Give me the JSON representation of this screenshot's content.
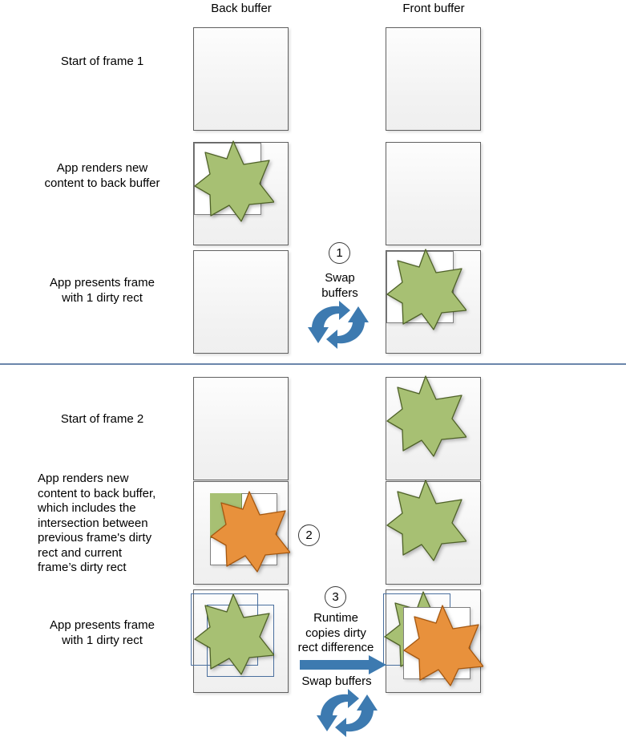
{
  "diagram": {
    "title": "Back buffer / front buffer dirty rect flip-model diagram",
    "colors": {
      "green_star": "#a7c073",
      "green_star_outline": "#4f6228",
      "orange_star": "#e8913c",
      "orange_star_outline": "#a5570f",
      "buffer_fill": "#f3f3f3",
      "buffer_border": "#616161",
      "dirty_rect_border": "#7f7f7f",
      "dirty_rect_blue_border": "#4a6f9e",
      "swap_arrow_blue": "#3d7ab0",
      "divider": "#6b86ab"
    }
  },
  "columns": {
    "back_buffer": "Back buffer",
    "front_buffer": "Front buffer"
  },
  "rows": {
    "r1": {
      "label": "Start of frame 1"
    },
    "r2": {
      "line1": "App renders new",
      "line2": "content to back buffer"
    },
    "r3": {
      "line1": "App presents frame",
      "line2": "with 1 dirty rect"
    },
    "r4": {
      "label": "Start of frame 2"
    },
    "r5": {
      "line1": "App renders new",
      "line2": "content to back buffer,",
      "line3": "which includes the",
      "line4": "intersection between",
      "line5": "previous frame's dirty",
      "line6": "rect and current",
      "line7": "frame’s dirty rect"
    },
    "r6": {
      "line1": "App presents frame",
      "line2": "with 1 dirty rect"
    }
  },
  "steps": {
    "step1": {
      "number": "1",
      "line1": "Swap",
      "line2": "buffers",
      "icon": "swap-buffers-icon"
    },
    "step2": {
      "number": "2"
    },
    "step3": {
      "number": "3",
      "line1": "Runtime",
      "line2": "copies dirty",
      "line3": "rect difference",
      "swap_label": "Swap buffers",
      "arrow_icon": "right-arrow-icon",
      "icon": "swap-buffers-icon"
    }
  }
}
